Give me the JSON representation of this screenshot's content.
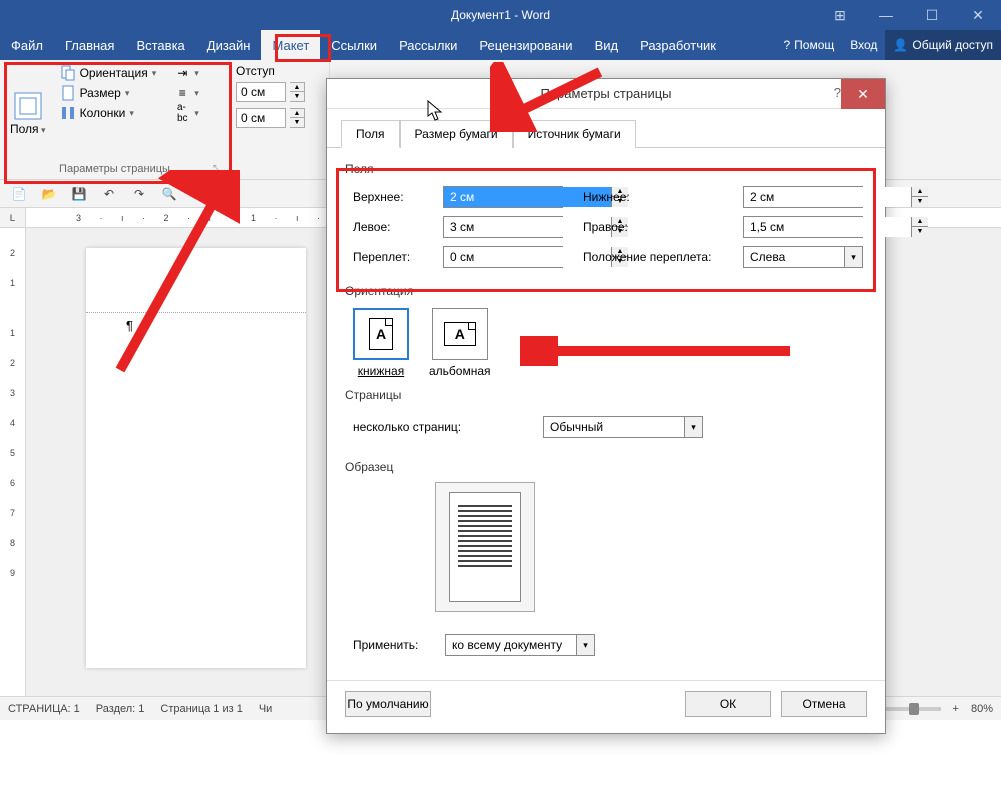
{
  "title": "Документ1 - Word",
  "ribbon": {
    "tabs": [
      "Файл",
      "Главная",
      "Вставка",
      "Дизайн",
      "Макет",
      "Ссылки",
      "Рассылки",
      "Рецензировани",
      "Вид",
      "Разработчик"
    ],
    "active": "Макет",
    "help": "Помощ",
    "login": "Вход",
    "share": "Общий доступ",
    "pagesetup": {
      "margins": "Поля",
      "orientation": "Ориентация",
      "size": "Размер",
      "columns": "Колонки",
      "group_label": "Параметры страницы",
      "indent_group": "Отступ",
      "indent_left": "0 см",
      "indent_right": "0 см"
    }
  },
  "ruler_h": "3 · ı · 2 · ı · 1 · ı ·   · ı · 1 · ı · 2",
  "ruler_v": [
    "2",
    "1",
    "",
    "1",
    "2",
    "3",
    "4",
    "5",
    "6",
    "7",
    "8",
    "9"
  ],
  "ruler_corner": "L",
  "statusbar": {
    "page": "СТРАНИЦА: 1",
    "section": "Раздел: 1",
    "pageof": "Страница 1 из 1",
    "chars": "Чи",
    "zoom": "80%"
  },
  "dialog": {
    "title": "Параметры страницы",
    "tabs": [
      "Поля",
      "Размер бумаги",
      "Источник бумаги"
    ],
    "active_tab": "Поля",
    "section_fields": "Поля",
    "top": {
      "label": "Верхнее:",
      "value": "2 см"
    },
    "bottom": {
      "label": "Нижнее:",
      "value": "2 см"
    },
    "left": {
      "label": "Левое:",
      "value": "3 см"
    },
    "right": {
      "label": "Правое:",
      "value": "1,5 см"
    },
    "gutter": {
      "label": "Переплет:",
      "value": "0 см"
    },
    "gutter_pos": {
      "label": "Положение переплета:",
      "value": "Слева"
    },
    "section_orient": "Ориентация",
    "orient_portrait": "книжная",
    "orient_landscape": "альбомная",
    "section_pages": "Страницы",
    "multi_pages_label": "несколько страниц:",
    "multi_pages_value": "Обычный",
    "section_sample": "Образец",
    "apply_label": "Применить:",
    "apply_value": "ко всему документу",
    "btn_default": "По умолчанию",
    "btn_ok": "ОК",
    "btn_cancel": "Отмена"
  }
}
